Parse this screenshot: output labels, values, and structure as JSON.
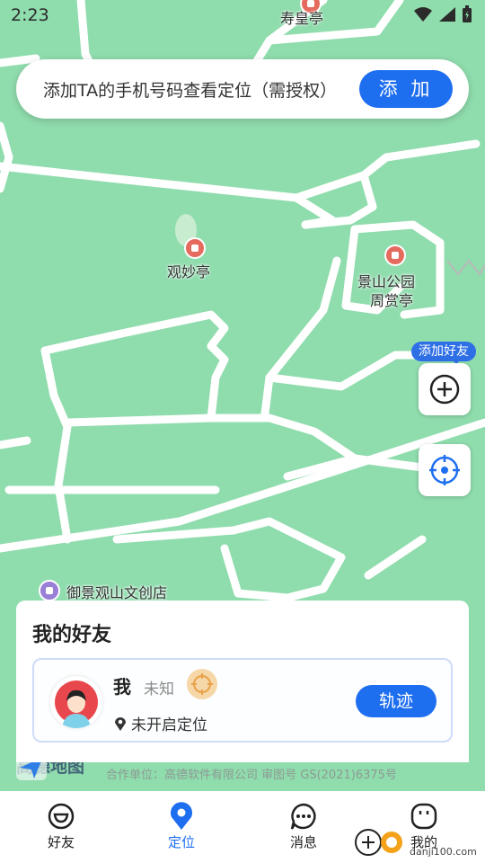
{
  "status": {
    "time": "2:23"
  },
  "map": {
    "pois": {
      "shouhuang": "寿皇亭",
      "guanmiao": "观妙亭",
      "jingshan": "景山公园",
      "zhoushang": "周赏亭",
      "yujing": "御景观山文创店"
    },
    "brand": "高德地图",
    "copyright": "合作单位：高德软件有限公司 审图号 GS(2021)6375号",
    "add_friend_tag": "添加好友"
  },
  "banner": {
    "text": "添加TA的手机号码查看定位（需授权）",
    "button": "添 加"
  },
  "friends_panel": {
    "title": "我的好友",
    "me": {
      "name": "我",
      "status": "未知",
      "location": "未开启定位",
      "track_button": "轨迹"
    }
  },
  "nav": {
    "items": [
      {
        "label": "好友",
        "icon": "friends-icon"
      },
      {
        "label": "定位",
        "icon": "location-pin-icon",
        "active": true
      },
      {
        "label": "消息",
        "icon": "message-icon"
      },
      {
        "label": "我的",
        "icon": "profile-icon"
      }
    ]
  },
  "watermark": {
    "text": "danji100.com"
  },
  "colors": {
    "accent": "#1e6ef0",
    "map_green": "#8fdcad"
  }
}
